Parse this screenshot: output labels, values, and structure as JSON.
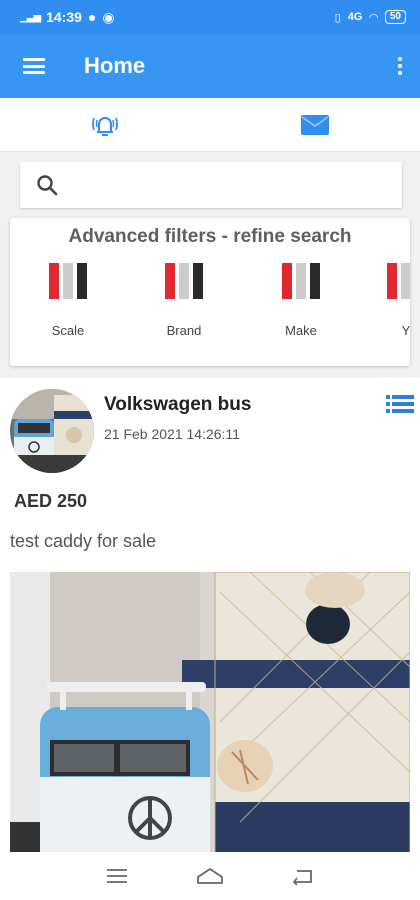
{
  "status_bar": {
    "time": "14:39",
    "network": "4G",
    "battery": "50"
  },
  "app_bar": {
    "title": "Home"
  },
  "tabs": [
    {
      "icon": "alarm-icon",
      "color": "#2f8ef0"
    },
    {
      "icon": "mail-icon",
      "color": "#2f8ef0"
    }
  ],
  "search": {
    "placeholder": "",
    "value": ""
  },
  "filters": {
    "title": "Advanced filters - refine search",
    "flag_colors": [
      "#e0282e",
      "#cccccc",
      "#2a2a2a"
    ],
    "items": [
      {
        "label": "Scale"
      },
      {
        "label": "Brand"
      },
      {
        "label": "Make"
      },
      {
        "label": "Y"
      }
    ]
  },
  "listing": {
    "title": "Volkswagen bus",
    "date": "21 Feb 2021 14:26:11",
    "price": "AED 250",
    "description": "test caddy for sale"
  },
  "colors": {
    "accent": "#3795f3",
    "status": "#2f8ef0"
  }
}
